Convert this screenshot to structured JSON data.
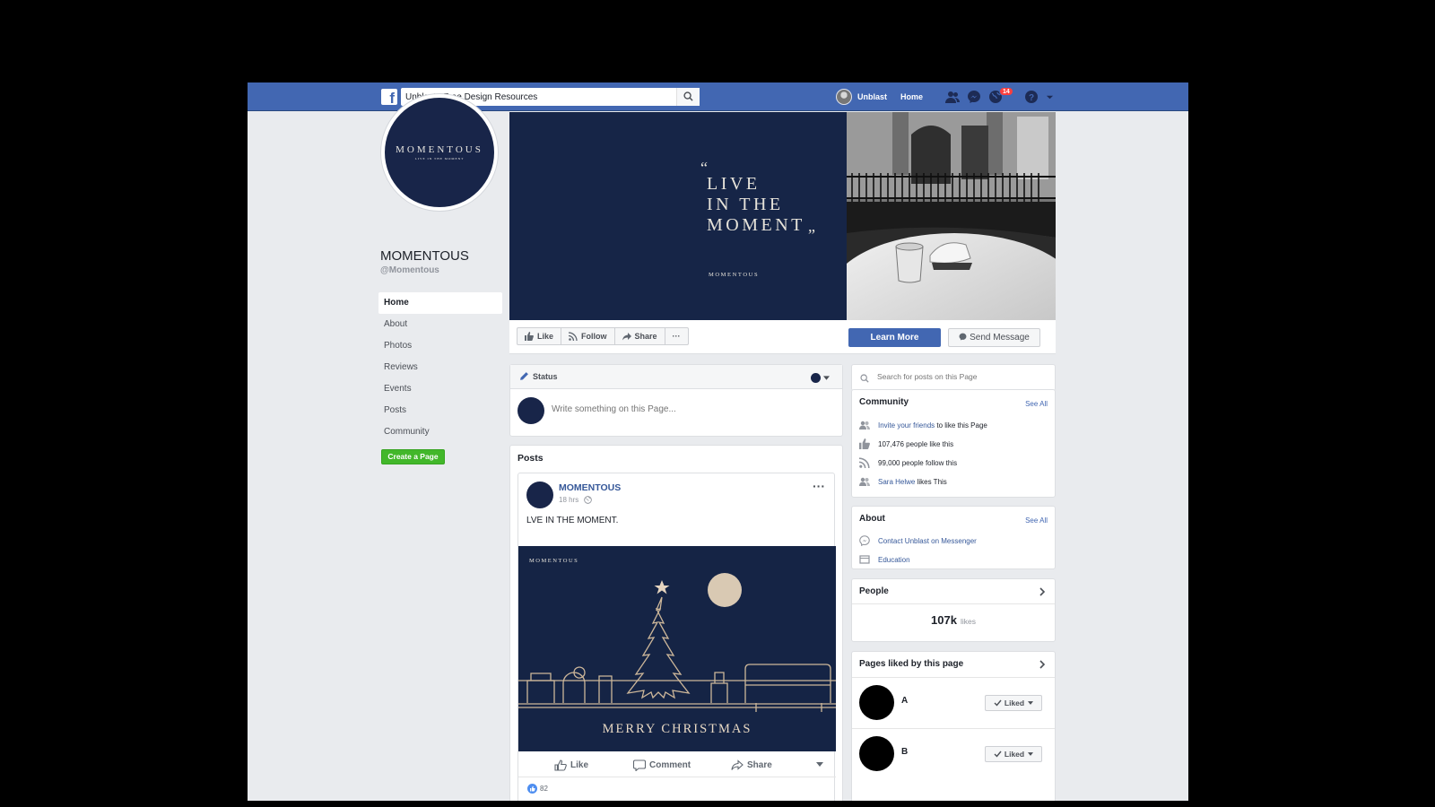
{
  "topbar": {
    "search_value": "Unblast : Free Design Resources",
    "user_name": "Unblast",
    "home_label": "Home",
    "notifications_count": "14",
    "brand_color": "#4267b2"
  },
  "profile": {
    "logo_title": "MOMENTOUS",
    "logo_tagline": "LIVE IN THE MOMENT",
    "page_name": "MOMENTOUS",
    "handle": "@Momentous"
  },
  "nav": {
    "items": [
      {
        "label": "Home"
      },
      {
        "label": "About"
      },
      {
        "label": "Photos"
      },
      {
        "label": "Reviews"
      },
      {
        "label": "Events"
      },
      {
        "label": "Posts"
      },
      {
        "label": "Community"
      }
    ],
    "create_page": "Create a Page"
  },
  "cover": {
    "quote_open": "“",
    "line1": "LIVE",
    "line2": "IN THE",
    "line3": "MOMENT",
    "quote_close": "”",
    "brand": "MOMENTOUS",
    "bg_color": "#162547"
  },
  "actions": {
    "like": "Like",
    "follow": "Follow",
    "share": "Share",
    "more": "···",
    "learn_more": "Learn More",
    "send_message": "Send Message"
  },
  "composer": {
    "status_label": "Status",
    "placeholder": "Write something on this Page..."
  },
  "posts": {
    "title": "Posts",
    "author": "MOMENTOUS",
    "time": "18 hrs",
    "more": "···",
    "text": "LVE IN THE MOMENT.",
    "image_brand": "MOMENTOUS",
    "image_caption": "MERRY CHRISTMAS",
    "actions": {
      "like": "Like",
      "comment": "Comment",
      "share": "Share"
    },
    "reactions_count": "82"
  },
  "right": {
    "search_placeholder": "Search for posts on this Page",
    "community": {
      "title": "Community",
      "see_all": "See All",
      "invite_link": "Invite your friends",
      "invite_rest": "to like this Page",
      "likes": "107,476 people like this",
      "follows": "99,000 people follow this",
      "friend_name": "Sara Helwe",
      "friend_rest": "likes This"
    },
    "about": {
      "title": "About",
      "see_all": "See All",
      "messenger": "Contact Unblast on Messenger",
      "category": "Education"
    },
    "people": {
      "title": "People",
      "count": "107k",
      "unit": "likes"
    },
    "pages_liked": {
      "title": "Pages liked by this page",
      "items": [
        {
          "name": "A",
          "button": "Liked"
        },
        {
          "name": "B",
          "button": "Liked"
        }
      ]
    }
  }
}
